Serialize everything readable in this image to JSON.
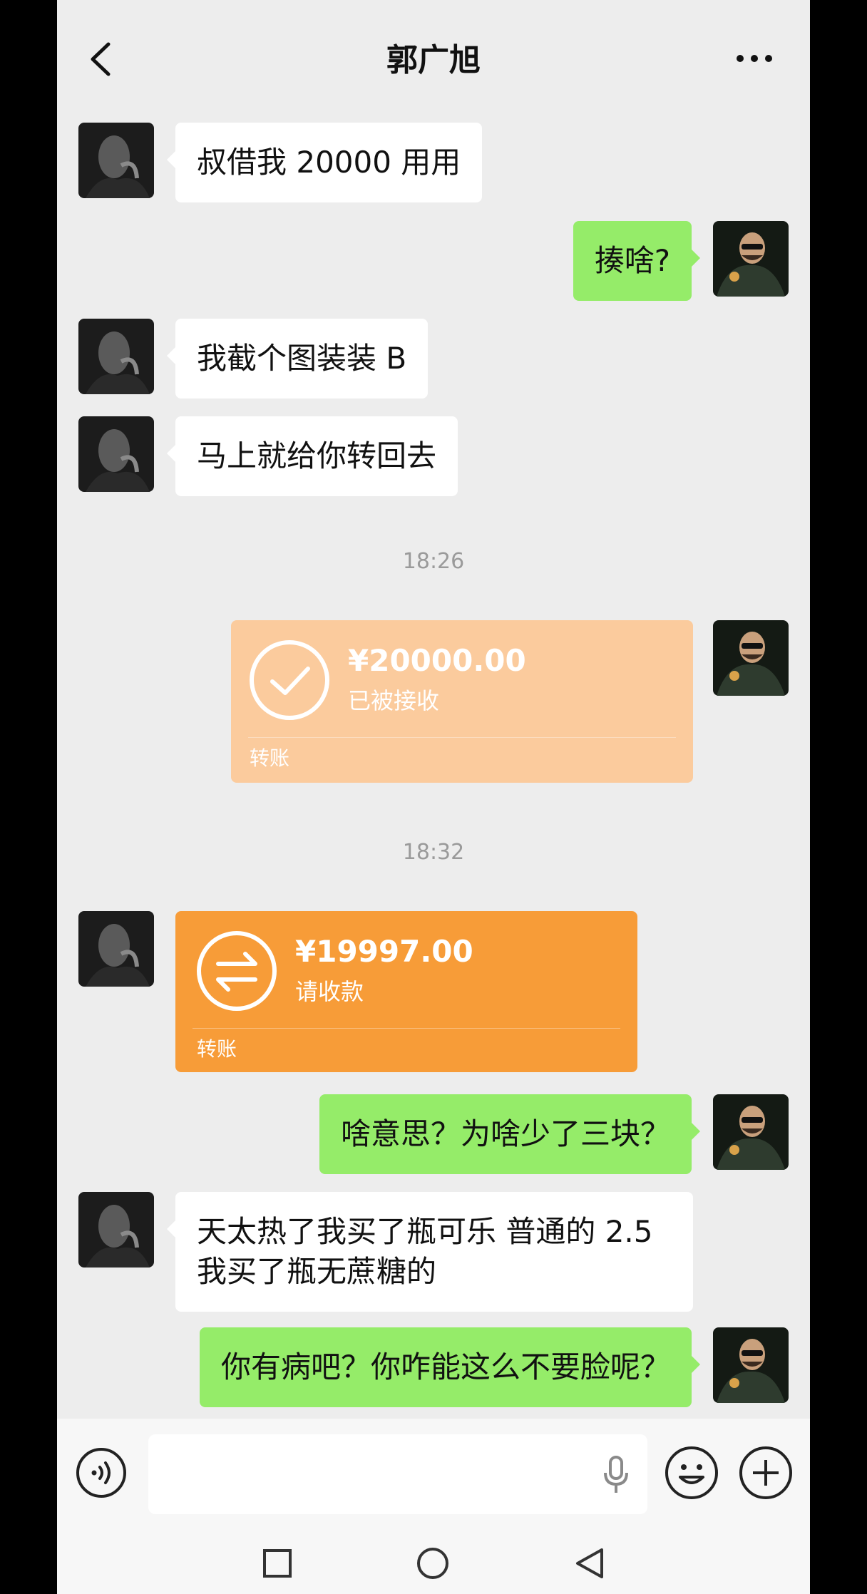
{
  "header": {
    "title": "郭广旭"
  },
  "messages": {
    "m1": "叔借我 20000 用用",
    "m2": "揍啥?",
    "m3": "我截个图装装 B",
    "m4": "马上就给你转回去",
    "time1": "18:26",
    "transfer1": {
      "amount": "¥20000.00",
      "status": "已被接收",
      "label": "转账"
    },
    "time2": "18:32",
    "transfer2": {
      "amount": "¥19997.00",
      "status": "请收款",
      "label": "转账"
    },
    "m5": "啥意思？为啥少了三块？",
    "m6_line1": "天太热了我买了瓶可乐 普通的 2.5",
    "m6_line2": "我买了瓶无蔗糖的",
    "m7": "你有病吧？你咋能这么不要脸呢？"
  },
  "colors": {
    "received_transfer": "#fbcb9d",
    "pending_transfer": "#f79c38",
    "green_bubble": "#95ec69",
    "background": "#ededed"
  },
  "icons": {
    "back": "chevron-left-icon",
    "more": "ellipsis-icon",
    "voice": "voice-icon",
    "mic": "microphone-icon",
    "emoji": "emoji-icon",
    "plus": "plus-icon"
  }
}
